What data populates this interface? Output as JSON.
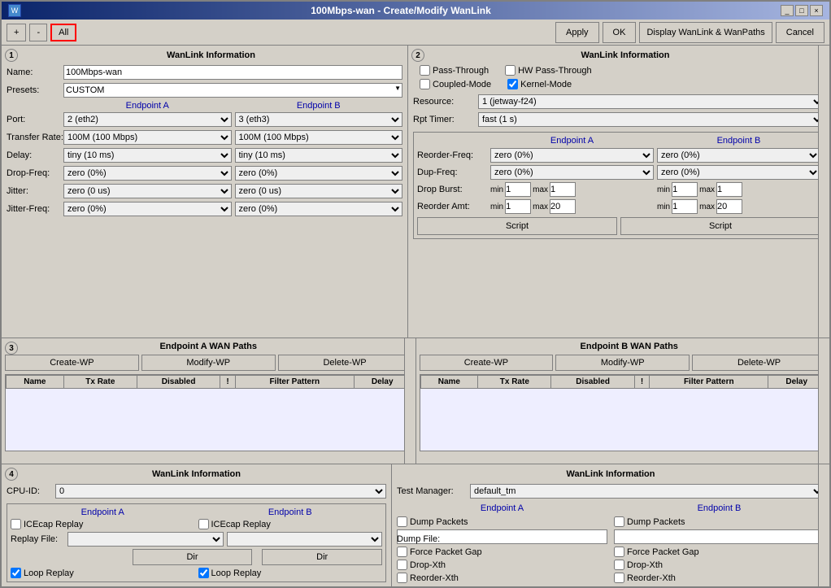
{
  "window": {
    "title": "100Mbps-wan - Create/Modify WanLink",
    "title_bar_buttons": [
      "_",
      "□",
      "×"
    ]
  },
  "toolbar": {
    "plus_label": "+",
    "minus_label": "-",
    "all_label": "All",
    "apply_label": "Apply",
    "ok_label": "OK",
    "display_label": "Display WanLink & WanPaths",
    "cancel_label": "Cancel"
  },
  "panel1": {
    "section_num": "1",
    "header": "WanLink Information",
    "name_label": "Name:",
    "name_value": "100Mbps-wan",
    "presets_label": "Presets:",
    "presets_value": "CUSTOM",
    "endpoint_a_label": "Endpoint A",
    "endpoint_b_label": "Endpoint B",
    "port_label": "Port:",
    "port_a": "2 (eth2)",
    "port_b": "3 (eth3)",
    "transfer_label": "Transfer Rate:",
    "transfer_a": "100M  (100 Mbps)",
    "transfer_b": "100M  (100 Mbps)",
    "delay_label": "Delay:",
    "delay_a": "tiny  (10 ms)",
    "delay_b": "tiny  (10 ms)",
    "dropfreq_label": "Drop-Freq:",
    "dropfreq_a": "zero  (0%)",
    "dropfreq_b": "zero  (0%)",
    "jitter_label": "Jitter:",
    "jitter_a": "zero  (0 us)",
    "jitter_b": "zero  (0 us)",
    "jitterfreq_label": "Jitter-Freq:",
    "jitterfreq_a": "zero  (0%)",
    "jitterfreq_b": "zero  (0%)"
  },
  "panel2": {
    "section_num": "2",
    "header": "WanLink Information",
    "passthrough_label": "Pass-Through",
    "hw_passthrough_label": "HW Pass-Through",
    "coupled_label": "Coupled-Mode",
    "kernel_label": "Kernel-Mode",
    "kernel_checked": true,
    "resource_label": "Resource:",
    "resource_value": "1 (jetway-f24)",
    "rpt_timer_label": "Rpt Timer:",
    "rpt_timer_value": "fast   (1 s)",
    "endpoint_a_label": "Endpoint A",
    "endpoint_b_label": "Endpoint B",
    "reorder_freq_label": "Reorder-Freq:",
    "reorder_freq_a": "zero (0%)",
    "reorder_freq_b": "zero (0%)",
    "dup_freq_label": "Dup-Freq:",
    "dup_freq_a": "zero (0%)",
    "dup_freq_b": "zero (0%)",
    "drop_burst_label": "Drop Burst:",
    "drop_burst_a_min": "1",
    "drop_burst_a_max": "1",
    "drop_burst_b_min": "1",
    "drop_burst_b_max": "1",
    "reorder_amt_label": "Reorder Amt:",
    "reorder_amt_a_min": "1",
    "reorder_amt_a_max": "20",
    "reorder_amt_b_min": "1",
    "reorder_amt_b_max": "20",
    "script_btn_label": "Script",
    "script_btn2_label": "Script"
  },
  "panel3": {
    "section_num": "3",
    "ep_a_header": "Endpoint A WAN Paths",
    "ep_b_header": "Endpoint B WAN Paths",
    "create_wp_label": "Create-WP",
    "modify_wp_label": "Modify-WP",
    "delete_wp_label": "Delete-WP",
    "col_name": "Name",
    "col_tx_rate": "Tx Rate",
    "col_disabled": "Disabled",
    "col_excl": "!",
    "col_filter": "Filter Pattern",
    "col_delay": "Delay"
  },
  "panel4": {
    "section_num": "4",
    "left_header": "WanLink Information",
    "right_header": "WanLink Information",
    "cpu_label": "CPU-ID:",
    "cpu_value": "0",
    "test_manager_label": "Test Manager:",
    "test_manager_value": "default_tm",
    "ep_a_label": "Endpoint A",
    "ep_b_label": "Endpoint B",
    "ep_a_right_label": "Endpoint A",
    "ep_b_right_label": "Endpoint B",
    "icecap_a_label": "ICEcap Replay",
    "icecap_b_label": "ICEcap Replay",
    "replay_label": "Replay File:",
    "dir_btn_label": "Dir",
    "loop_label": "Loop Replay",
    "dump_packets_a_label": "Dump Packets",
    "dump_packets_b_label": "Dump Packets",
    "dump_file_label": "Dump File:",
    "force_gap_a_label": "Force Packet Gap",
    "force_gap_b_label": "Force Packet Gap",
    "drop_xth_a_label": "Drop-Xth",
    "drop_xth_b_label": "Drop-Xth",
    "reorder_xth_a_label": "Reorder-Xth",
    "reorder_xth_b_label": "Reorder-Xth"
  }
}
